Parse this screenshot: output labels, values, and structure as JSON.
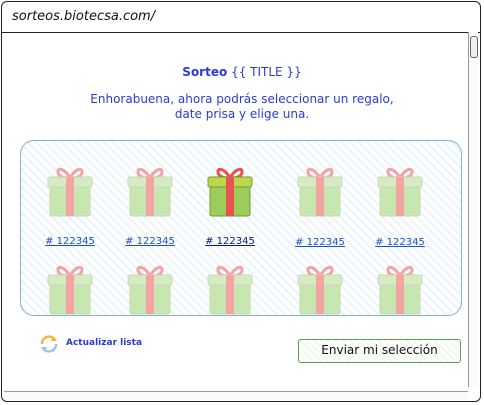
{
  "browser": {
    "url": "sorteos.biotecsa.com/"
  },
  "header": {
    "title_bold": "Sorteo",
    "title_placeholder": "{{ TITLE }}",
    "message_line1": "Enhorabuena, ahora podrás seleccionar un regalo,",
    "message_line2": "date prisa y elige una."
  },
  "gifts": [
    {
      "label": "# 122345",
      "selected": false
    },
    {
      "label": "# 122345",
      "selected": false
    },
    {
      "label": "# 122345",
      "selected": true
    },
    {
      "label": "# 122345",
      "selected": false
    },
    {
      "label": "# 122345",
      "selected": false
    }
  ],
  "footer": {
    "refresh_label": "Actualizar lista",
    "send_label": "Enviar mi selección"
  },
  "colors": {
    "text_blue": "#2b3bd6",
    "link_blue": "#1a4fd8",
    "gift_green_light": "#c8e6b0",
    "gift_ribbon_light": "#f3a3a3",
    "gift_green_selected": "#9ccc5a",
    "gift_ribbon_selected": "#e8534f",
    "panel_border": "#7fb3d9",
    "button_border": "#5e9c55"
  },
  "icons": {
    "refresh": "refresh-icon",
    "gift": "gift-icon"
  }
}
